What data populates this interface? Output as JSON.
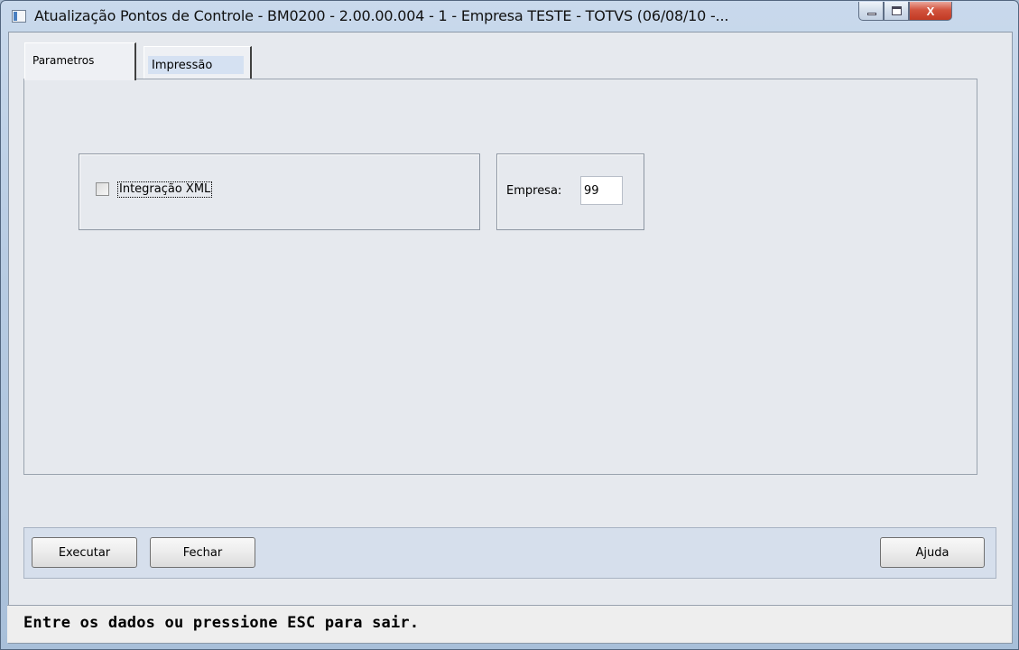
{
  "window": {
    "title": "Atualização Pontos de Controle - BM0200 - 2.00.00.004 - 1 - Empresa TESTE - TOTVS (06/08/10 -...",
    "buttons": {
      "close_glyph": "X"
    }
  },
  "tabs": [
    {
      "label": "Parametros",
      "active": true
    },
    {
      "label": "Impressão",
      "active": false
    }
  ],
  "parametros": {
    "integracao_xml_label": "Integração XML",
    "integracao_xml_checked": false,
    "empresa_label": "Empresa:",
    "empresa_value": "99"
  },
  "actions": {
    "executar": "Executar",
    "fechar": "Fechar",
    "ajuda": "Ajuda"
  },
  "status": {
    "message": "Entre os dados ou pressione ESC para sair."
  },
  "colors": {
    "title_bar": "#b8cce3",
    "client_bg": "#e6e9ee",
    "button_bar_bg": "#d6dfec",
    "close_button": "#c23a23"
  }
}
